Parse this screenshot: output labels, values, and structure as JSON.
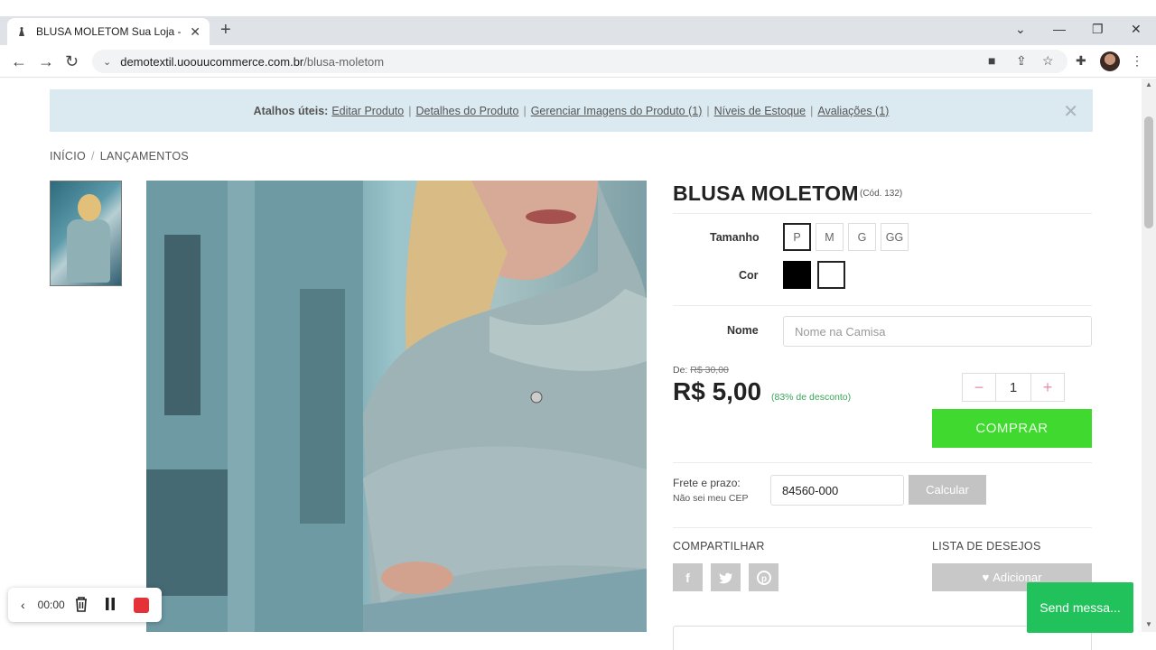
{
  "browser": {
    "tab_title": "BLUSA MOLETOM Sua Loja - O m",
    "url_domain": "demotextil.uoouucommerce.com.br",
    "url_path": "/blusa-moletom",
    "new_tab": "+",
    "close": "✕"
  },
  "shortcuts": {
    "heading": "Atalhos úteis:",
    "links": [
      "Editar Produto",
      "Detalhes do Produto",
      "Gerenciar Imagens do Produto (1)",
      "Níveis de Estoque",
      "Avaliações (1)"
    ],
    "close": "✕"
  },
  "breadcrumb": [
    "INÍCIO",
    "LANÇAMENTOS"
  ],
  "product": {
    "name": "BLUSA MOLETOM",
    "code": "(Cód. 132)",
    "size_label": "Tamanho",
    "sizes": [
      "P",
      "M",
      "G",
      "GG"
    ],
    "selected_size": "P",
    "color_label": "Cor",
    "colors": [
      "#000000",
      "#ffffff"
    ],
    "name_label": "Nome",
    "name_placeholder": "Nome na Camisa",
    "old_price_prefix": "De:",
    "old_price": "R$ 30,00",
    "price": "R$ 5,00",
    "discount": "(83% de desconto)",
    "quantity": "1",
    "qty_minus": "−",
    "qty_plus": "+",
    "buy_label": "COMPRAR"
  },
  "shipping": {
    "label": "Frete e prazo:",
    "cep_link": "Não sei meu CEP",
    "cep_value": "84560-000",
    "calc_label": "Calcular"
  },
  "social": {
    "share_label": "COMPARTILHAR",
    "icons": [
      "facebook-icon",
      "twitter-icon",
      "pinterest-icon"
    ],
    "wishlist_label": "LISTA DE DESEJOS",
    "wishlist_button": "Adicionar"
  },
  "recorder": {
    "time": "00:00"
  },
  "chat": {
    "label": "Send messa..."
  },
  "colors": {
    "buy_green": "#3fd92f",
    "shortcut_bg": "#dbeaf0",
    "discount_green": "#3aa55a",
    "chat_green": "#21c15b",
    "stop_red": "#e53238"
  }
}
